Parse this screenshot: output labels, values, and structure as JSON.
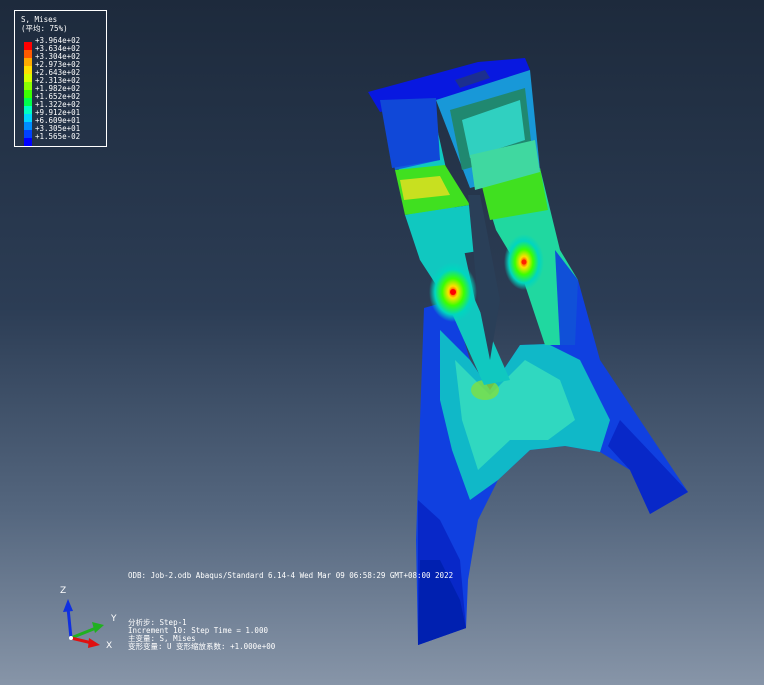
{
  "legend": {
    "title": "S, Mises",
    "subtitle": "(平均: 75%)",
    "values": [
      "+3.964e+02",
      "+3.634e+02",
      "+3.304e+02",
      "+2.973e+02",
      "+2.643e+02",
      "+2.313e+02",
      "+1.982e+02",
      "+1.652e+02",
      "+1.322e+02",
      "+9.912e+01",
      "+6.609e+01",
      "+3.305e+01",
      "+1.565e-02"
    ],
    "colors": [
      "#ff0000",
      "#ff5a00",
      "#ffab00",
      "#ffe000",
      "#d7ff00",
      "#8cff00",
      "#3cff00",
      "#00ff4b",
      "#00ffc3",
      "#00d6ff",
      "#008cff",
      "#0041ff",
      "#0000ff"
    ]
  },
  "info": {
    "odb_line": "ODB: Job-2.odb    Abaqus/Standard 6.14-4    Wed Mar 09 06:58:29 GMT+08:00 2022",
    "step_line": "分析步: Step-1",
    "increment_line": "Increment     10: Step Time =    1.000",
    "primary_line": "主变量: S, Mises",
    "deformed_line": "变形变量: U   变形缩放系数: +1.000e+00"
  },
  "triad": {
    "x": "X",
    "y": "Y",
    "z": "Z"
  }
}
